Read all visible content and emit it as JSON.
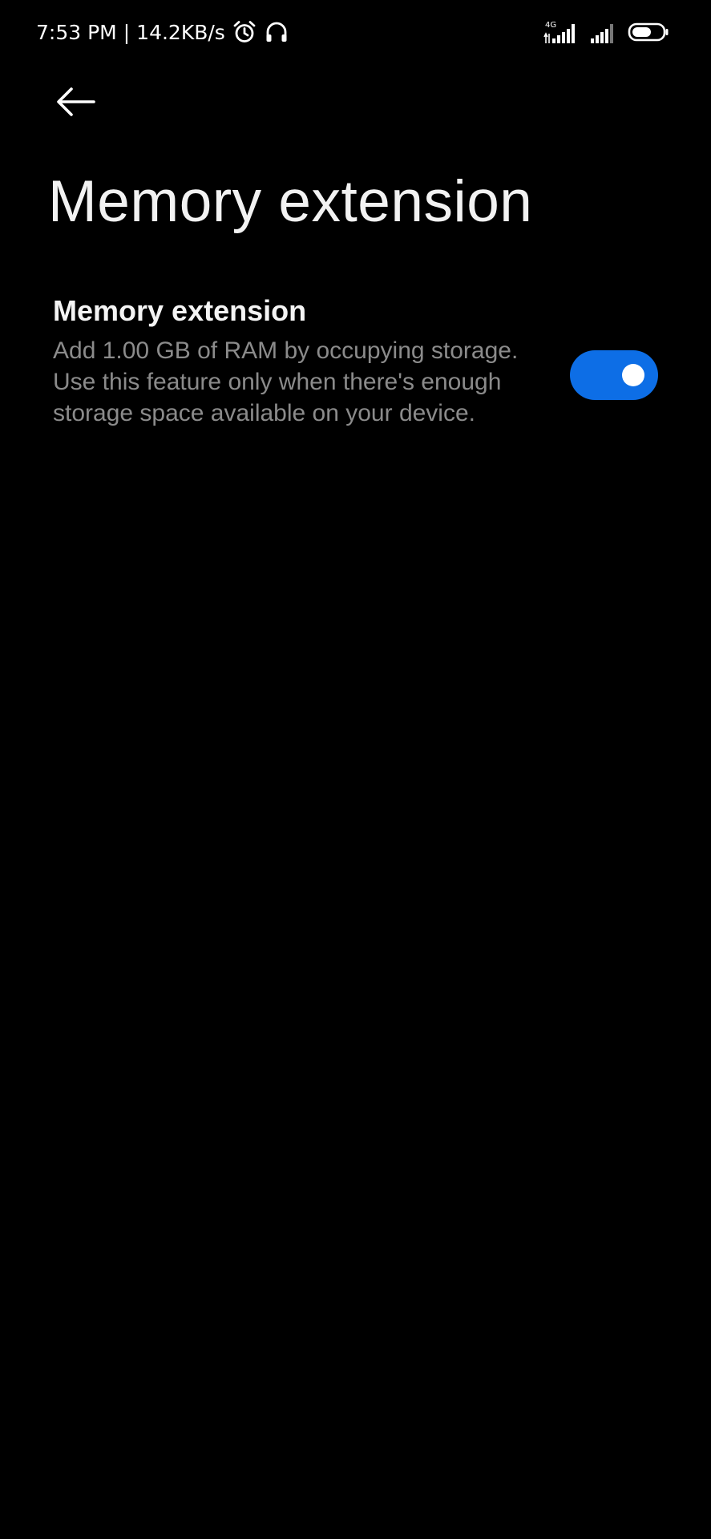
{
  "status_bar": {
    "time": "7:53 PM",
    "separator": "|",
    "network_speed": "14.2KB/s",
    "network_type": "4G",
    "icons": [
      "alarm-icon",
      "headphones-icon",
      "signal-4g-icon",
      "signal-icon",
      "battery-icon"
    ]
  },
  "header": {
    "back_icon": "arrow-left-icon",
    "title": "Memory extension"
  },
  "setting": {
    "title": "Memory extension",
    "summary": "Add 1.00 GB of RAM by occupying storage. Use this feature only when there's enough storage space available on your device.",
    "enabled": true
  },
  "colors": {
    "background": "#000000",
    "accent": "#0d6ee6",
    "title_text": "#f2f2f2",
    "summary_text": "#8b8b8b"
  }
}
